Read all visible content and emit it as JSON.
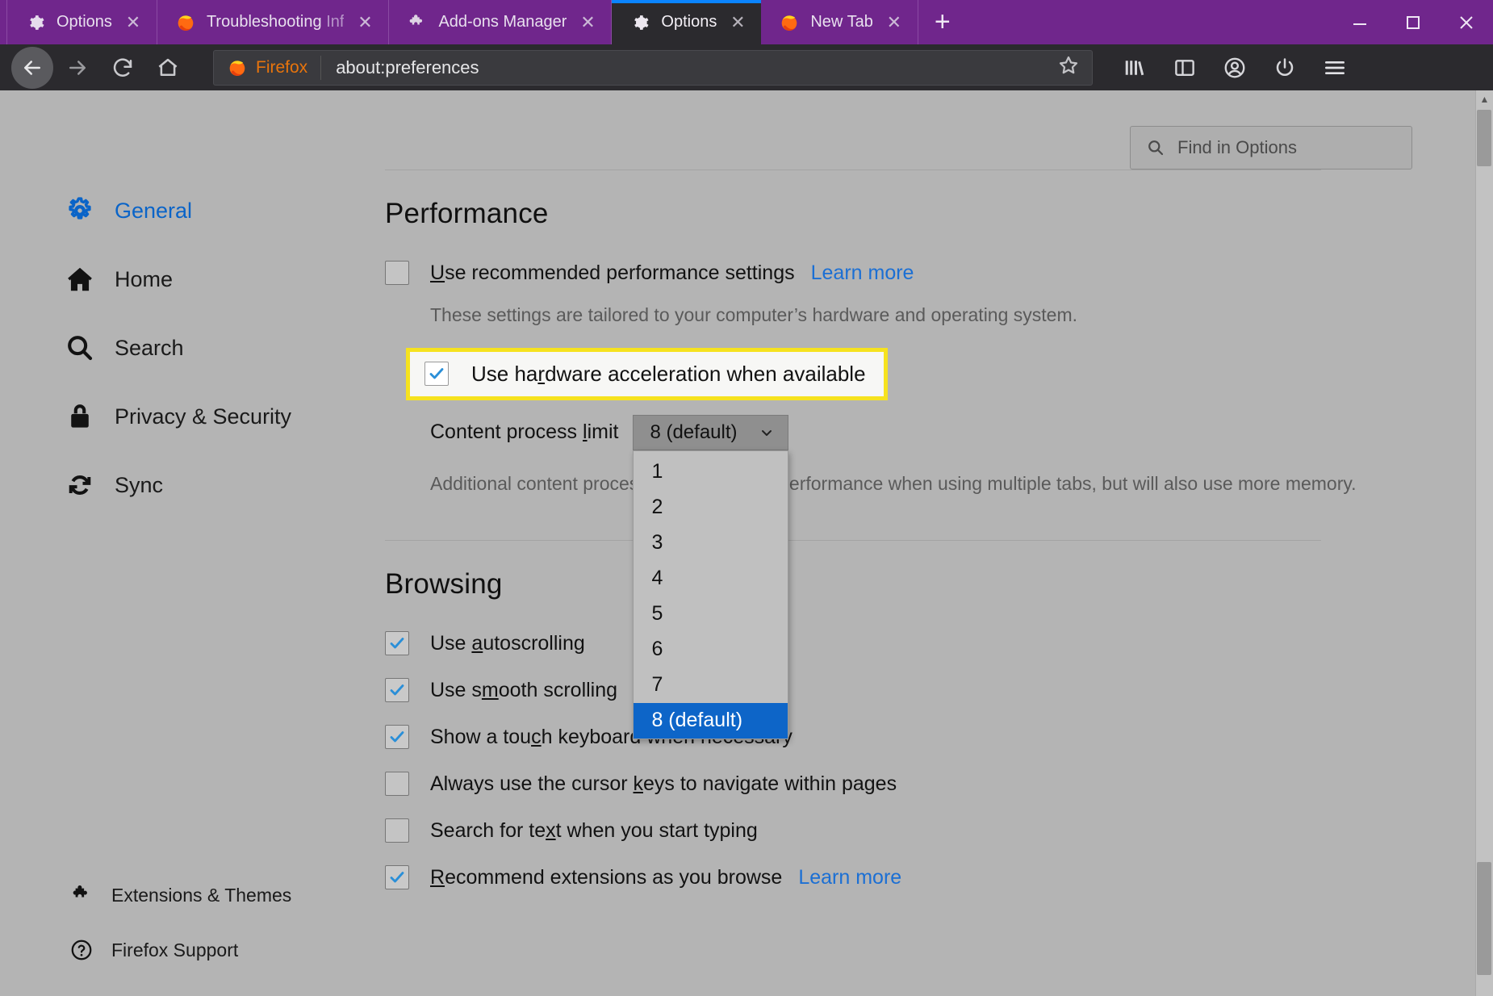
{
  "window": {
    "tabs": [
      {
        "title": "Options",
        "icon": "gear-icon",
        "close": "✕",
        "active": false
      },
      {
        "title": "Troubleshooting",
        "title_faded": "Inf",
        "icon": "firefox-icon",
        "close": "✕",
        "active": false
      },
      {
        "title": "Add-ons Manager",
        "icon": "puzzle-icon",
        "close": "✕",
        "active": false
      },
      {
        "title": "Options",
        "icon": "gear-icon",
        "close": "✕",
        "active": true
      },
      {
        "title": "New Tab",
        "icon": "firefox-icon",
        "close": "✕",
        "active": false
      }
    ],
    "new_tab_label": "+",
    "minimize_label": "—",
    "maximize_label": "□",
    "close_label": "✕",
    "accent_tabbar": "#70268c",
    "active_tab_bg": "#2b2a2e",
    "active_tab_accent": "#0a84ff"
  },
  "toolbar": {
    "back_label": "back-arrow",
    "forward_label": "forward-arrow",
    "reload_label": "reload",
    "home_label": "home",
    "identity_brand": "Firefox",
    "url_value": "about:preferences",
    "bookmark_label": "star",
    "library_label": "library",
    "sidebar_label": "sidebar",
    "account_label": "account",
    "power_label": "power",
    "menu_label": "menu"
  },
  "search": {
    "placeholder": "Find in Options",
    "icon": "search-icon"
  },
  "sidebar": {
    "items": [
      {
        "label": "General",
        "icon": "gear-icon",
        "active": true
      },
      {
        "label": "Home",
        "icon": "home-icon",
        "active": false
      },
      {
        "label": "Search",
        "icon": "search-icon",
        "active": false
      },
      {
        "label": "Privacy & Security",
        "icon": "lock-icon",
        "active": false
      },
      {
        "label": "Sync",
        "icon": "sync-icon",
        "active": false
      }
    ],
    "bottom_items": [
      {
        "label": "Extensions & Themes",
        "icon": "puzzle-icon"
      },
      {
        "label": "Firefox Support",
        "icon": "help-circle-icon"
      }
    ],
    "active_color": "#0a64c8"
  },
  "performance": {
    "title": "Performance",
    "recommended": {
      "label_pre": "",
      "label_accesskey": "U",
      "label_post": "se recommended performance settings",
      "checked": false,
      "learn_more": "Learn more"
    },
    "description": "These settings are tailored to your computer’s hardware and operating system.",
    "hardware_acceleration": {
      "label_pre": "Use ha",
      "label_accesskey": "r",
      "label_post": "dware acceleration when available",
      "checked": true,
      "highlight_color": "#f6e21e"
    },
    "content_process": {
      "label_pre": "Content process ",
      "label_accesskey": "l",
      "label_post": "imit",
      "selected_value": "8 (default)",
      "chevron": "⌄",
      "options": [
        "1",
        "2",
        "3",
        "4",
        "5",
        "6",
        "7",
        "8 (default)"
      ],
      "selected_index": 7,
      "selected_bg": "#0d65c8"
    },
    "extra_description": "Additional content processes can improve performance when using multiple tabs, but will also use more memory."
  },
  "browsing": {
    "title": "Browsing",
    "items": [
      {
        "label_pre": "Use ",
        "label_accesskey": "a",
        "label_post": "utoscrolling",
        "checked": true,
        "learn_more": null
      },
      {
        "label_pre": "Use s",
        "label_accesskey": "m",
        "label_post": "ooth scrolling",
        "checked": true,
        "learn_more": null
      },
      {
        "label_pre": "Show a tou",
        "label_accesskey": "c",
        "label_post": "h keyboard when necessary",
        "checked": true,
        "learn_more": null
      },
      {
        "label_pre": "Always use the cursor ",
        "label_accesskey": "k",
        "label_post": "eys to navigate within pages",
        "checked": false,
        "learn_more": null
      },
      {
        "label_pre": "Search for te",
        "label_accesskey": "x",
        "label_post": "t when you start typing",
        "checked": false,
        "learn_more": null
      },
      {
        "label_pre": "",
        "label_accesskey": "R",
        "label_post": "ecommend extensions as you browse",
        "checked": true,
        "learn_more": "Learn more"
      }
    ]
  },
  "scrollbar": {
    "up_arrow": "▲",
    "down_arrow": "▼"
  }
}
